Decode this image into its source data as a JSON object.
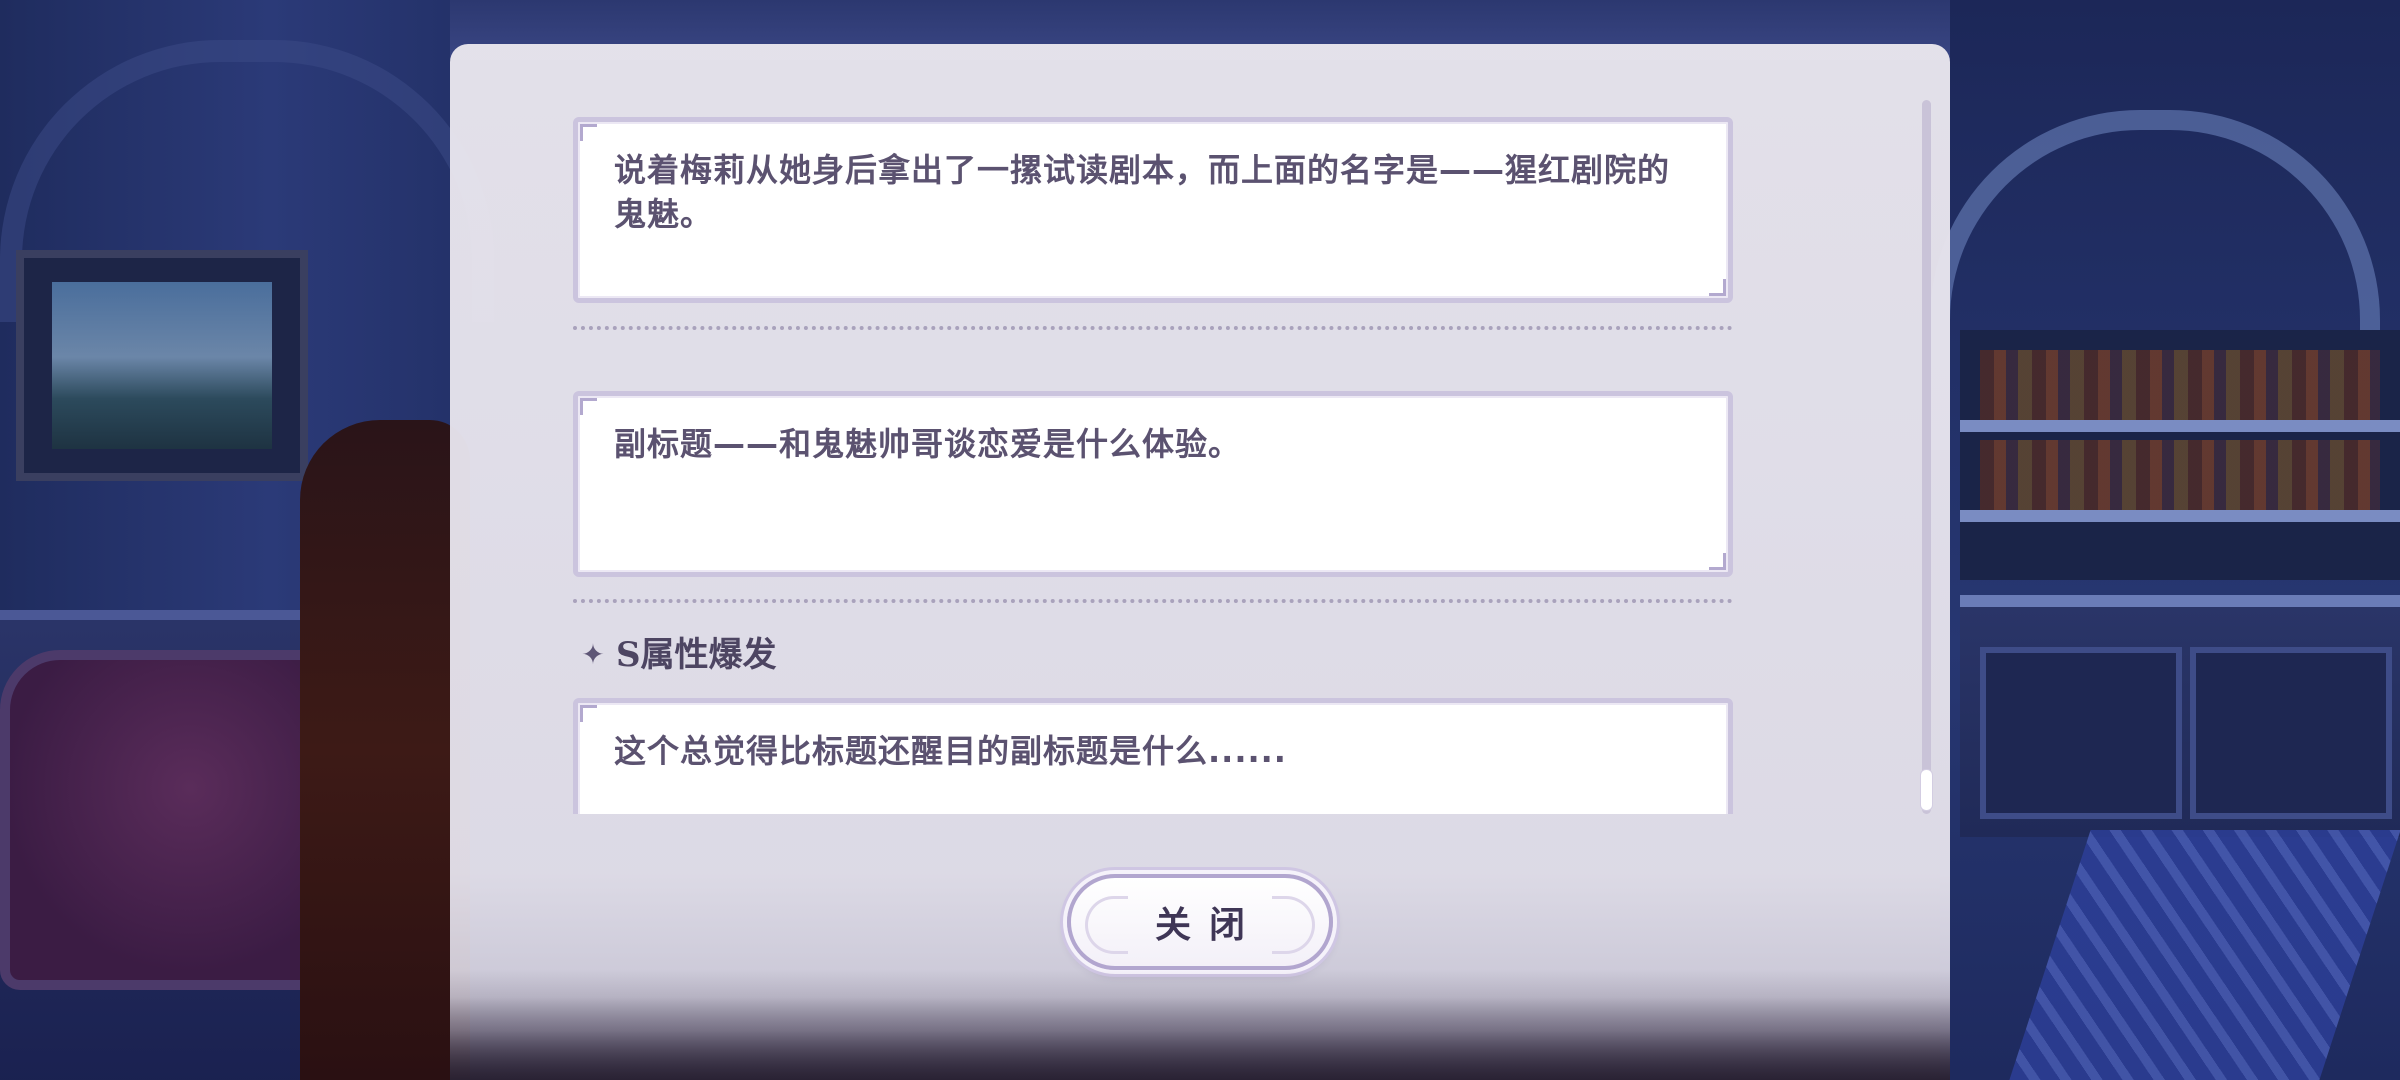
{
  "dialog": {
    "entries": [
      {
        "text": "说着梅莉从她身后拿出了一摞试读剧本，而上面的名字是——猩红剧院的鬼魅。"
      },
      {
        "text": "副标题——和鬼魅帅哥谈恋爱是什么体验。"
      }
    ],
    "section": {
      "icon": "sparkle-icon",
      "title": "S属性爆发",
      "text": "这个总觉得比标题还醒目的副标题是什么......"
    },
    "close_label": "关闭"
  },
  "colors": {
    "panel_bg": "#e9e6ee",
    "card_border": "#cbc4de",
    "text": "#5b5270",
    "heading": "#4d4562",
    "button_border": "#b2a6cf"
  }
}
